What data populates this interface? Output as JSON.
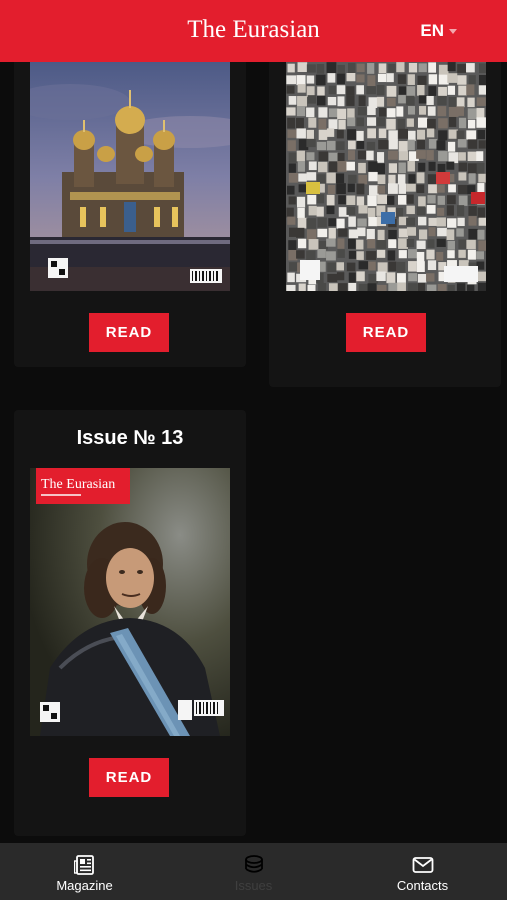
{
  "header": {
    "title": "The Eurasian",
    "language": "EN"
  },
  "issues": [
    {
      "read_label": "READ",
      "cover_description": "Cathedral with golden domes at dusk",
      "cover_icon": "cathedral-cover-image"
    },
    {
      "read_label": "READ",
      "cover_description": "Crowd holding portraits",
      "cover_icon": "crowd-cover-image"
    },
    {
      "title": "Issue № 13",
      "read_label": "READ",
      "cover_masthead": "The Eurasian",
      "cover_description": "Portrait of Peter the Great",
      "cover_icon": "portrait-cover-image"
    }
  ],
  "nav": {
    "magazine": "Magazine",
    "issues": "Issues",
    "contacts": "Contacts"
  },
  "colors": {
    "brand_red": "#e31e2d",
    "background": "#0c0c0c",
    "card": "#141414",
    "nav_bg": "#2a2a2a"
  }
}
